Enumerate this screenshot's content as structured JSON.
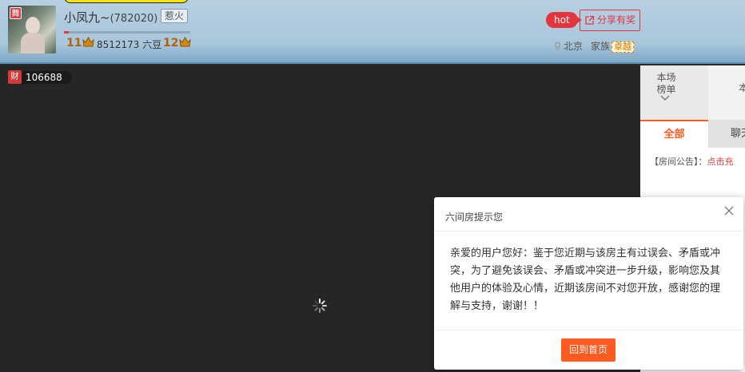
{
  "header": {
    "anchor_name": "小凤九~",
    "anchor_id": "(782020)",
    "huo_label": "惹火",
    "avatar_badge": "舞",
    "level_left": "11",
    "level_right": "12",
    "beans_value": "8512173",
    "beans_unit": "六豆",
    "progress": 0.04,
    "hot_label": "hot",
    "share_label": "分享有奖",
    "location": "北京",
    "family_label": "家族",
    "family_tag": "卓越"
  },
  "video": {
    "wealth_icon": "财",
    "wealth_value": "106688"
  },
  "sidebar": {
    "rank_line1": "本场",
    "rank_line2": "榜单",
    "rank_other": "本",
    "tab_all": "全部",
    "tab_chat": "聊天",
    "notice_label": "【房间公告】：",
    "notice_link": "点击充"
  },
  "modal": {
    "title": "六间房提示您",
    "message": "亲爱的用户您好：鉴于您近期与该房主有过误会、矛盾或冲突，为了避免该误会、矛盾或冲突进一步升级，影响您及其他用户的体验及心情，近期该房间不对您开放，感谢您的理解与支持，谢谢！！",
    "home_button": "回到首页"
  },
  "colors": {
    "accent_orange": "#ff5a1f",
    "hot_red": "#e3353c"
  },
  "icons": [
    "crown-icon",
    "share-icon",
    "location-icon",
    "chevron-down-icon",
    "close-icon",
    "loading-spinner-icon"
  ]
}
